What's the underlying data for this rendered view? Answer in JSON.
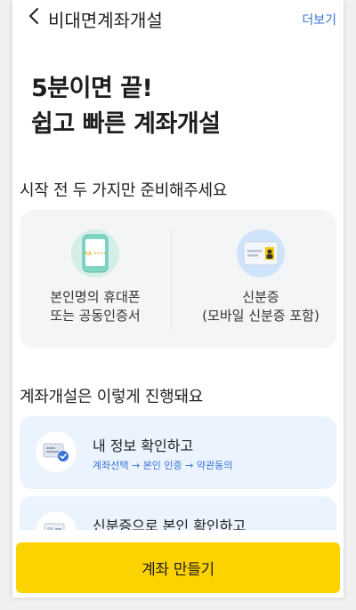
{
  "header": {
    "title": "비대면계좌개설",
    "more_label": "더보기"
  },
  "hero": {
    "line1": "5분이면 끝!",
    "line2": "쉽고 빠른 계좌개설"
  },
  "prep": {
    "section_title": "시작 전 두 가지만 준비해주세요",
    "items": [
      {
        "line1": "본인명의 휴대폰",
        "line2": "또는 공동인증서",
        "icon": "phone-icon",
        "screen_text": "AA ••••"
      },
      {
        "line1": "신분증",
        "line2": "(모바일 신분증 포함)",
        "icon": "id-card-icon"
      }
    ]
  },
  "process": {
    "section_title": "계좌개설은 이렇게 진행돼요",
    "steps": [
      {
        "title": "내 정보 확인하고",
        "sub": "계좌선택 → 본인 인증 → 약관동의",
        "icon": "profile-check-icon"
      },
      {
        "title": "신분증으로 본인 확인하고",
        "sub": "",
        "icon": "id-scan-icon"
      }
    ]
  },
  "cta": {
    "label": "계좌 만들기"
  },
  "colors": {
    "accent_yellow": "#fcd200",
    "link_blue": "#3a72d6",
    "step_bg": "#eaf3fe",
    "prep_bg": "#f4f5f7"
  }
}
